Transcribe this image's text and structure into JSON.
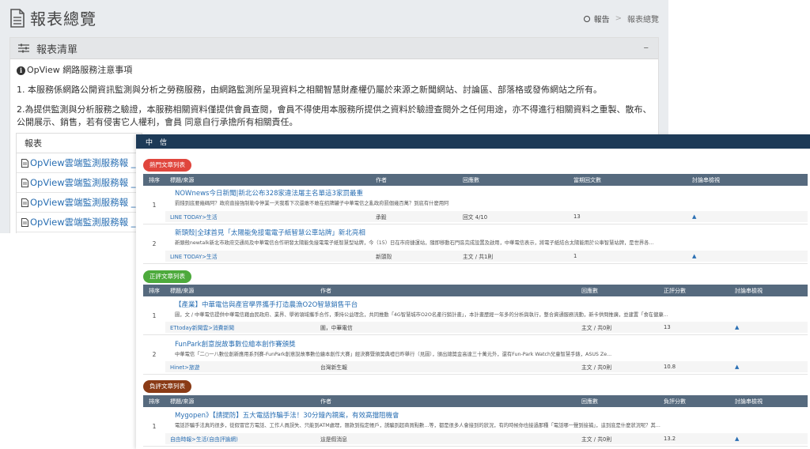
{
  "page": {
    "title": "報表總覽",
    "breadcrumb": [
      "報告",
      "報表總覽"
    ]
  },
  "panel": {
    "title": "報表清單",
    "collapse_glyph": "–",
    "notice_title": "OpView 網路服務注意事項",
    "notice_1": "1. 本服務係網路公開資訊監測與分析之勞務服務，由網路監測所呈現資料之相關智慧財產權仍屬於來源之新聞網站、討論區、部落格或發佈網站之所有。",
    "notice_2": "2.為提供監測與分析服務之驗證，本服務相關資料僅提供會員查閱，會員不得使用本服務所提供之資料於驗證查閱外之任何用途，亦不得進行相關資料之重製、散布、公開展示、銷售，若有侵害它人權利，會員 同意自行承擔所有相關責任。"
  },
  "report_table": {
    "header": "報表",
    "rows": [
      "OpView雲端監測服務報 _20",
      "OpView雲端監測服務報 _20",
      "OpView雲端監測服務報 _20",
      "OpView雲端監測服務報 _20"
    ]
  },
  "overlay": {
    "bar_title": "中信",
    "hot": {
      "label": "熱門文章列表",
      "headers": [
        "排序",
        "標題/來源",
        "作者",
        "回應數",
        "當期回文數",
        "討論串檢視"
      ],
      "rows": [
        {
          "num": "1",
          "title": "NOWnews今日新聞|新北公布328家違法屠主名單這3家罰最重",
          "desc": "罰錢到底要幾碼阿？政府直接強制勒令停業一天我看下次還敢不敢在招牌罐子中華電信之亂政府罰個幾百萬？到底有什麼用阿",
          "source": "LINE TODAY>生活",
          "author": "承毅",
          "replies": "回文 4/10",
          "period": "13",
          "view": "▲"
        },
        {
          "num": "2",
          "title": "新頭殼|全球首見「太陽能免接電電子紙智慧公車站牌」新北亮相",
          "desc": "新頭殼newtalk新北市政府交通局及中華電信合作研發太陽能免接電電子紙智慧型站牌，今（15）日在市府捷運站，隨即移動石門區完成設置及啟用，中華電信表示，將電子紙結合太陽能用於公車智慧站牌，是世界各...",
          "source": "LINE TODAY>生活",
          "author": "新頭殼",
          "replies": "主文 / 共1則",
          "period": "1",
          "view": "▲"
        }
      ]
    },
    "positive": {
      "label": "正評文章列表",
      "headers": [
        "排序",
        "標題/來源",
        "作者",
        "回應數",
        "正評分數",
        "討論串檢視"
      ],
      "rows": [
        {
          "num": "1",
          "title": "【產業】中華電信與產官學界攜手打造農漁O2O智慧銷售平台",
          "desc": "圖，文 / 中華電信提供中華電信藉由民政府、業界、學術領域攜手合作，秉持公益理念，共同推動「4G智慧城市O2O名產行銷計畫」，本計畫歷經一年多的分析與執行，整合資通服務流動，新卡供問推廣，並建置「食在健康...",
          "source": "ETtoday新聞雲>消費新聞",
          "author": "圖，中華電信",
          "replies": "主文 / 共0則",
          "score": "13",
          "view": "▲"
        },
        {
          "num": "2",
          "title": "FunPark創意說故事數位繪本創作賽頒獎",
          "desc": "中華電信「二○一八數位創新應用系列賽-FunPark創意說故事數位繪本創作大賽」經決賽暨頒獎典禮日昨舉行（見圖），頒出總獎金高達三十萬元外，還有Fun-Park Watch兒童智慧手錶，ASUS Ze...",
          "source": "Hinet>旅遊",
          "author": "台灣新生報",
          "replies": "主文 / 共0則",
          "score": "10.8",
          "view": "▲"
        }
      ]
    },
    "negative": {
      "label": "負評文章列表",
      "headers": [
        "排序",
        "標題/來源",
        "作者",
        "回應數",
        "負評分數",
        "討論串檢視"
      ],
      "rows": [
        {
          "num": "1",
          "title": "Mygopen》【請提防】五大電話詐騙手法！30分鐘內親案，有效高擋阻機會",
          "desc": "電話詐騙手法真的很多，從假冒官方電話、工作人員誤失、只能到ATM處理，匯款到指定帳戶，誘騙到超商買點數...等，都是很多人會接到的狀況，有的時候你也接過那種「電話哪一聲到接捕」，這到底是什麼狀況呢？其...",
          "source": "自由時報>生活(自由評論網)",
          "author": "這是假消息",
          "replies": "主文 / 共0則",
          "score": "13.2",
          "view": "▲"
        }
      ]
    }
  }
}
